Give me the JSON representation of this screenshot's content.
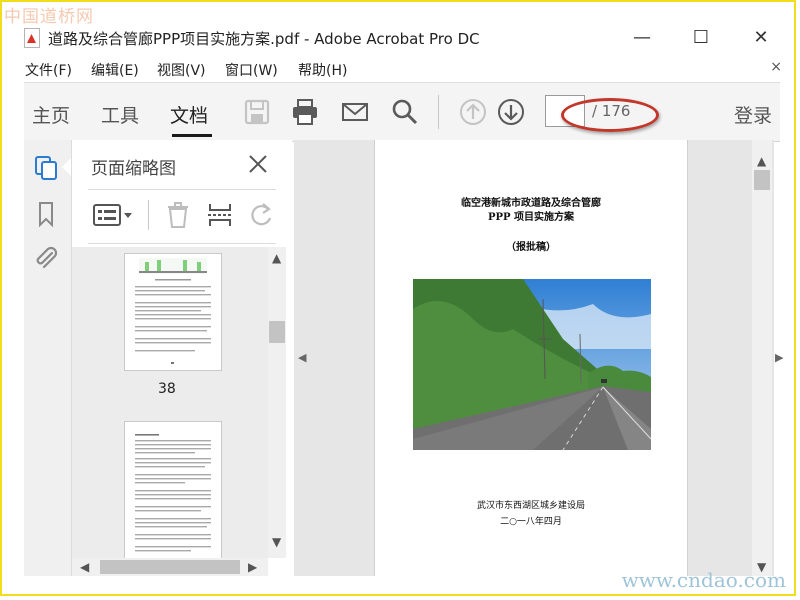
{
  "watermark": {
    "top": "中国道桥网",
    "bottom": "www.cndao.com"
  },
  "window": {
    "title": "道路及综合管廊PPP项目实施方案.pdf - Adobe Acrobat Pro DC",
    "minimize": "—",
    "maximize": "☐",
    "close": "✕"
  },
  "menu": {
    "items": [
      "文件(F)",
      "编辑(E)",
      "视图(V)",
      "窗口(W)",
      "帮助(H)"
    ],
    "close": "×"
  },
  "toolbar": {
    "tabs": [
      "主页",
      "工具",
      "文档"
    ],
    "active_tab": "文档",
    "page_current": "",
    "page_total": "/ 176",
    "login": "登录"
  },
  "panel": {
    "title": "页面缩略图",
    "thumb_page_label": "38"
  },
  "document": {
    "title_line1": "临空港新城市政道路及综合管廊",
    "title_line2": "PPP 项目实施方案",
    "subtitle": "（报批稿）",
    "issuer": "武汉市东西湖区城乡建设局",
    "date": "二○一八年四月"
  },
  "colors": {
    "annotation": "#c1382a",
    "toolbar_bg": "#f4f4f4",
    "rail_active_icon": "#2b7bd0"
  }
}
